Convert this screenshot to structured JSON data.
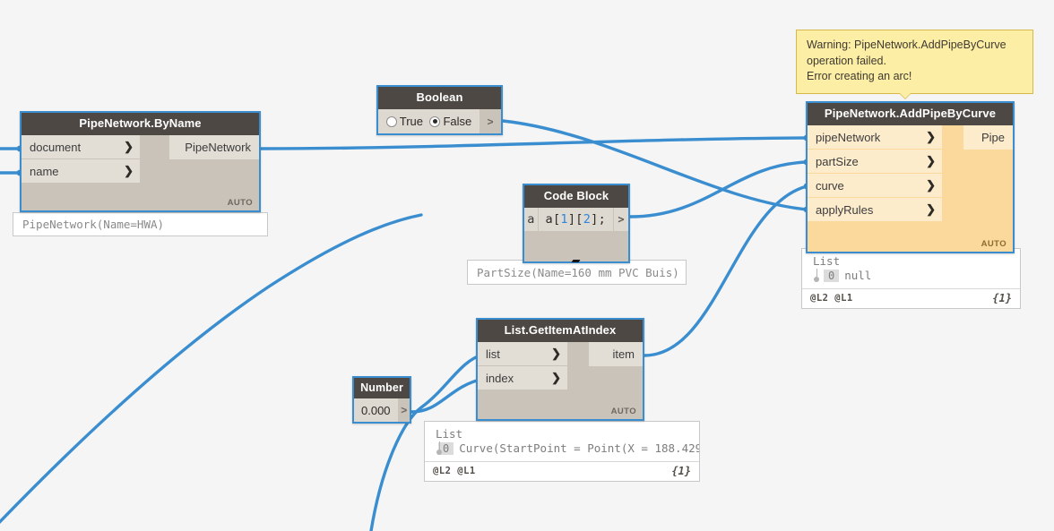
{
  "canvas": {
    "background": "#f5f5f5",
    "wire_color": "#3a8ed0"
  },
  "warning_tooltip": {
    "line1": "Warning: PipeNetwork.AddPipeByCurve",
    "line2": "operation failed.",
    "line3": "Error creating an arc!",
    "background": "#fdeea6",
    "border": "#d9b84a"
  },
  "nodes": {
    "pipenetwork_byname": {
      "title": "PipeNetwork.ByName",
      "inputs": [
        {
          "label": "document",
          "chevron": "❯"
        },
        {
          "label": "name",
          "chevron": "❯"
        }
      ],
      "output": "PipeNetwork",
      "auto": "AUTO"
    },
    "boolean": {
      "title": "Boolean",
      "option_true": "True",
      "option_false": "False",
      "selected": "False",
      "out_chevron": ">"
    },
    "code_block": {
      "title": "Code Block",
      "in_label": "a",
      "code_prefix": "a",
      "code_index1": "1",
      "code_index2": "2",
      "code_full": "a[1][2];",
      "out_chevron": ">"
    },
    "list_getitematindex": {
      "title": "List.GetItemAtIndex",
      "inputs": [
        {
          "label": "list",
          "chevron": "❯"
        },
        {
          "label": "index",
          "chevron": "❯"
        }
      ],
      "output": "item",
      "auto": "AUTO"
    },
    "number": {
      "title": "Number",
      "value": "0.000",
      "out_chevron": ">"
    },
    "addpipebycurve": {
      "title": "PipeNetwork.AddPipeByCurve",
      "inputs": [
        {
          "label": "pipeNetwork",
          "chevron": "❯"
        },
        {
          "label": "partSize",
          "chevron": "❯"
        },
        {
          "label": "curve",
          "chevron": "❯"
        },
        {
          "label": "applyRules",
          "chevron": "❯"
        }
      ],
      "output": "Pipe",
      "auto": "AUTO",
      "state": "warning",
      "body_color": "#fbd89b"
    }
  },
  "previews": {
    "pipenetwork_byname": {
      "text": "PipeNetwork(Name=HWA)"
    },
    "code_block": {
      "text": "PartSize(Name=160 mm PVC Buis)"
    }
  },
  "list_previews": {
    "addpipebycurve": {
      "label": "List",
      "index": "0",
      "value": "null",
      "levels": "@L2 @L1",
      "count": "{1}"
    },
    "list_getitematindex": {
      "label": "List",
      "index": "0",
      "value": "Curve(StartPoint = Point(X = 188.429",
      "levels": "@L2 @L1",
      "count": "{1}"
    }
  }
}
